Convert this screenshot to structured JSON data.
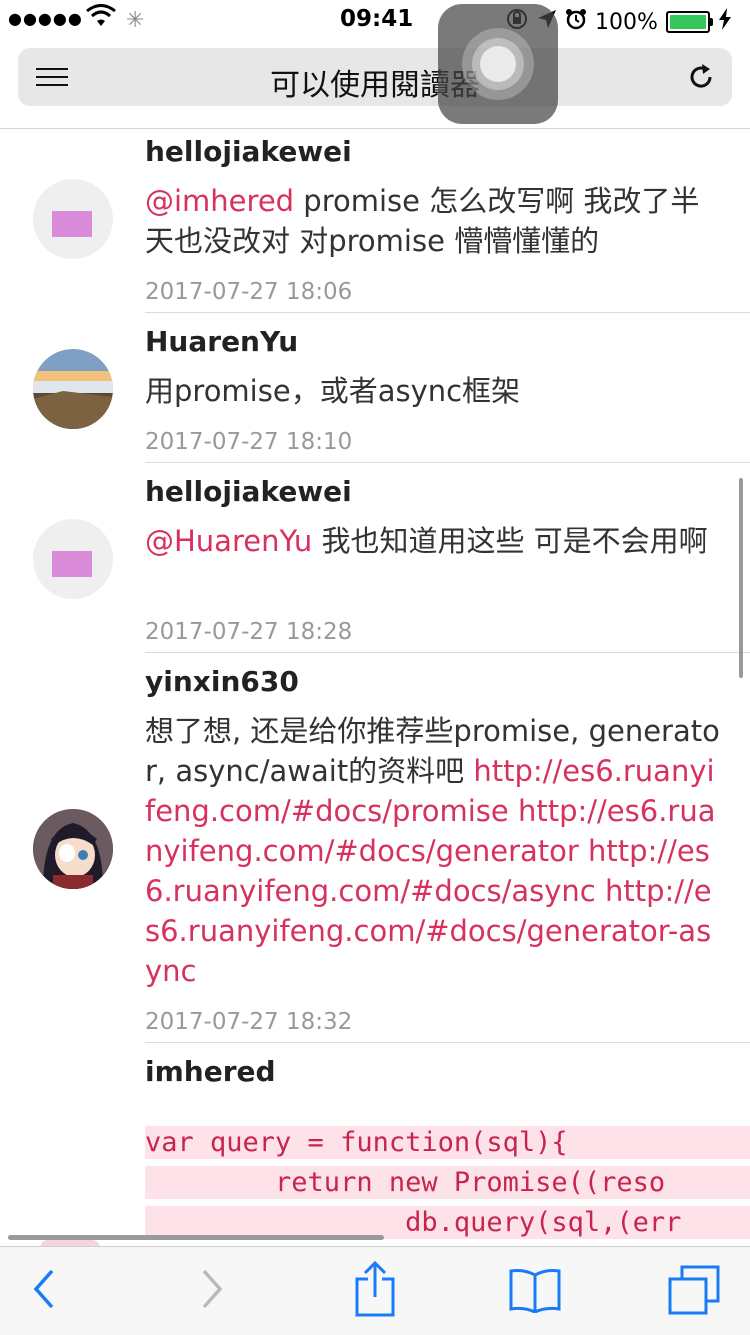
{
  "status": {
    "signal": "●●●●●",
    "time": "09:41",
    "battery": "100%"
  },
  "urlbar": {
    "title": "可以使用閱讀器"
  },
  "comments": [
    {
      "user": "hellojiakewei",
      "mention": "@imhered",
      "text": " promise 怎么改写啊 我改了半天也没改对 对promise 懵懵懂懂的",
      "time": "2017-07-27 18:06"
    },
    {
      "user": "HuarenYu",
      "mention": "",
      "text": "用promise，或者async框架",
      "time": "2017-07-27 18:10"
    },
    {
      "user": "hellojiakewei",
      "mention": "@HuarenYu",
      "text": " 我也知道用这些 可是不会用啊",
      "time": "2017-07-27 18:28"
    },
    {
      "user": "yinxin630",
      "text": "想了想, 还是给你推荐些promise, generator, async/await的资料吧 ",
      "links": "http://es6.ruanyifeng.com/#docs/promise http://es6.ruanyifeng.com/#docs/generator http://es6.ruanyifeng.com/#docs/async http://es6.ruanyifeng.com/#docs/generator-async",
      "time": "2017-07-27 18:32"
    },
    {
      "user": "imhered",
      "code": [
        "var query = function(sql){",
        "        return new Promise((reso",
        "                db.query(sql,(err"
      ]
    }
  ],
  "colors": {
    "accent": "#d7325e",
    "ios_blue": "#1a7cf5"
  }
}
